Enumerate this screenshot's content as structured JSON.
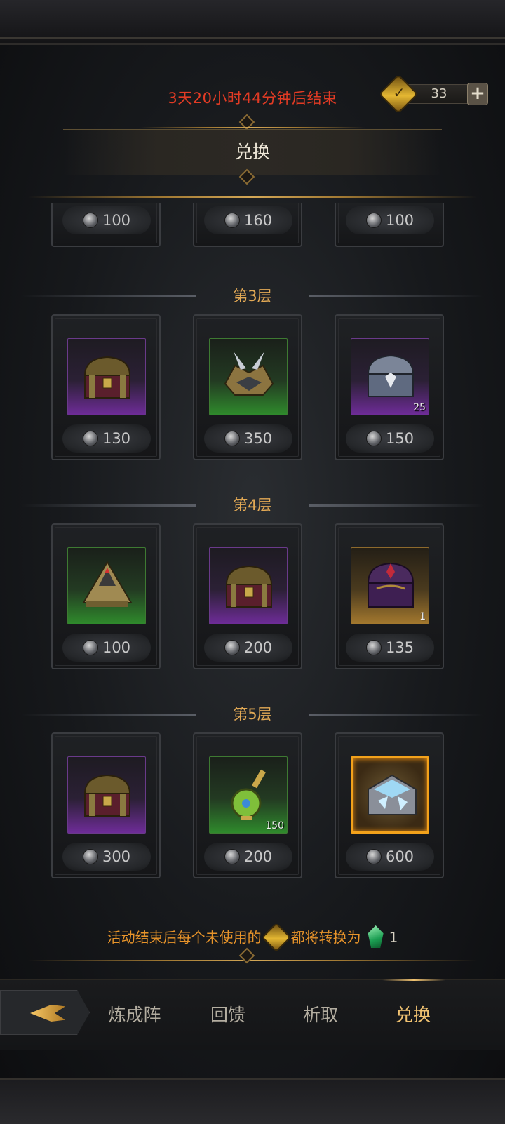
{
  "header": {
    "timer_text": "3天20小时44分钟后结束",
    "currency_amount": "33",
    "add_icon": "plus-icon",
    "title": "兑换"
  },
  "shop": {
    "top_row_prices": [
      "100",
      "160",
      "100"
    ],
    "tiers": [
      {
        "label": "第3层",
        "items": [
          {
            "art": "purple-treasure-chest",
            "quality": "purple",
            "quantity": "",
            "price": "130"
          },
          {
            "art": "spiked-armor-piece",
            "quality": "green",
            "quantity": "",
            "price": "350"
          },
          {
            "art": "silver-chest",
            "quality": "purple",
            "quantity": "25",
            "price": "150"
          }
        ]
      },
      {
        "label": "第4层",
        "items": [
          {
            "art": "golden-pyramid-relic",
            "quality": "green",
            "quantity": "",
            "price": "100"
          },
          {
            "art": "purple-treasure-chest",
            "quality": "purple",
            "quantity": "",
            "price": "200"
          },
          {
            "art": "dark-purple-chest",
            "quality": "gold",
            "quantity": "1",
            "price": "135"
          }
        ]
      },
      {
        "label": "第5层",
        "items": [
          {
            "art": "purple-treasure-chest",
            "quality": "purple",
            "quantity": "",
            "price": "300"
          },
          {
            "art": "green-potion-scepter",
            "quality": "green",
            "quantity": "150",
            "price": "200"
          },
          {
            "art": "legendary-crystal-chest",
            "quality": "orange",
            "quantity": "",
            "price": "600"
          }
        ]
      }
    ]
  },
  "footer_note": {
    "prefix": "活动结束后每个未使用的",
    "middle": "都将转换为",
    "amount": "1"
  },
  "tabs": [
    {
      "label": "炼成阵",
      "active": false
    },
    {
      "label": "回馈",
      "active": false
    },
    {
      "label": "析取",
      "active": false
    },
    {
      "label": "兑换",
      "active": true
    }
  ],
  "colors": {
    "timer": "#e23b24",
    "tier_label": "#e2a955",
    "footnote": "#e8942a",
    "active_tab": "#f0c271",
    "quality_purple": "#6e2c98",
    "quality_green": "#2f8a2c",
    "quality_gold": "#a3782e",
    "quality_orange": "#f3a21b"
  }
}
